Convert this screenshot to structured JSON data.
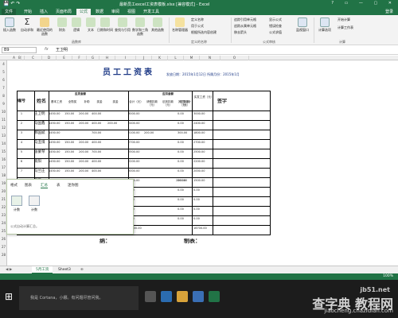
{
  "window": {
    "title": "最新员工excel工资表模板.xlsx [兼容模式] - Excel",
    "controls": "? ▭ — ▢ ✕"
  },
  "ribbon_tabs": [
    "文件",
    "开始",
    "插入",
    "页面布局",
    "公式",
    "数据",
    "审阅",
    "视图",
    "开发工具"
  ],
  "active_tab": "公式",
  "user": "登录",
  "ribbon": {
    "insert_function": "插入函数",
    "autosum": "自动求和",
    "recent": "最近使用的函数",
    "financial": "财务",
    "logical": "逻辑",
    "text": "文本",
    "datetime": "日期和时间",
    "lookup": "查找与引用",
    "math": "数学和三角函数",
    "more": "其他函数",
    "group_library": "函数库",
    "name_manager": "名称管理器",
    "define_name": "定义名称",
    "use_in_formula": "用于公式",
    "create_from_selection": "根据所选内容创建",
    "group_names": "定义的名称",
    "trace_precedents": "追踪引用单元格",
    "trace_dependents": "追踪从属单元格",
    "remove_arrows": "移去箭头",
    "show_formulas": "显示公式",
    "error_checking": "错误检查",
    "evaluate_formula": "公式求值",
    "group_auditing": "公式审核",
    "watch_window": "监视窗口",
    "calc_options": "计算选项",
    "calc_now": "开始计算",
    "calc_sheet": "计算工作表",
    "group_calc": "计算"
  },
  "formula_bar": {
    "name_box": "B9",
    "fx": "fx",
    "value": "王卫明"
  },
  "columns": [
    "A",
    "B",
    "C",
    "D",
    "E",
    "F",
    "G",
    "H",
    "I",
    "J",
    "K",
    "L",
    "M",
    "N",
    "O"
  ],
  "rows": [
    "4",
    "5",
    "6",
    "7",
    "8",
    "9",
    "10",
    "11",
    "12",
    "13",
    "14",
    "15",
    "16",
    "17",
    "18",
    "19",
    "20",
    "21",
    "22",
    "23",
    "24",
    "25",
    "26",
    "27",
    "28"
  ],
  "sheet": {
    "title": "员工工资表",
    "meta": "发放日期：2015年1月12日  所属月份：2015年1月",
    "h_no": "编号",
    "h_name": "姓名",
    "h_payable": "应发金额",
    "h_deduct": "应扣金额",
    "h_actual": "实发工资（元）",
    "h_sign": "签字",
    "sub_headers": [
      "基本工资",
      "全勤奖",
      "补助",
      "奖金",
      "奖金",
      "合计（元）",
      "请假扣款（元）",
      "迟到扣款（元）",
      "其它扣款（元）",
      "应扣合计（元）"
    ],
    "rows": [
      {
        "no": "1",
        "name": "王卫明",
        "vals": [
          "1450.00",
          "150.00",
          "200.00",
          "400.00",
          "",
          "3000.00",
          "",
          "",
          "",
          "0.00",
          "3000.00"
        ]
      },
      {
        "no": "2",
        "name": "马国鑫",
        "vals": [
          "1450.00",
          "150.00",
          "200.00",
          "400.00",
          "200.00",
          "2400.00",
          "",
          "",
          "",
          "0.00",
          "2400.00"
        ]
      },
      {
        "no": "3",
        "name": "郝国斌",
        "vals": [
          "1450.00",
          "",
          "",
          "700.00",
          "",
          "2100.00",
          "200.00",
          "",
          "",
          "300.00",
          "1800.00"
        ]
      },
      {
        "no": "4",
        "name": "马丑煤",
        "vals": [
          "1450.00",
          "150.00",
          "200.00",
          "400.00",
          "",
          "2700.00",
          "",
          "",
          "",
          "0.00",
          "2700.00"
        ]
      },
      {
        "no": "5",
        "name": "张蒙琴",
        "vals": [
          "1450.00",
          "150.00",
          "200.00",
          "700.00",
          "",
          "2500.00",
          "",
          "",
          "",
          "0.00",
          "2500.00"
        ]
      },
      {
        "no": "6",
        "name": "高阳",
        "vals": [
          "1450.00",
          "150.00",
          "200.00",
          "400.00",
          "",
          "2200.00",
          "",
          "",
          "",
          "0.00",
          "2200.00"
        ]
      },
      {
        "no": "7",
        "name": "马兰庄",
        "vals": [
          "1450.00",
          "150.00",
          "200.00",
          "400.00",
          "",
          "2000.00",
          "",
          "",
          "",
          "0.00",
          "2000.00"
        ]
      },
      {
        "no": "8",
        "name": "浑雁",
        "vals": [
          "1450.00",
          "0.00",
          "100.00",
          "150.00",
          "0.00",
          "1700.00",
          "",
          "",
          "200.00",
          "200.00",
          "1500.00"
        ]
      },
      {
        "no": "9",
        "name": "",
        "vals": [
          "",
          "",
          "",
          "",
          "",
          "0.00",
          "",
          "",
          "",
          "0.00",
          "0.00"
        ]
      },
      {
        "no": "",
        "name": "",
        "vals": [
          "",
          "",
          "",
          "",
          "",
          "0.00",
          "",
          "",
          "",
          "0.00",
          "0.00"
        ]
      },
      {
        "no": "",
        "name": "",
        "vals": [
          "",
          "",
          "",
          "",
          "",
          "0.00",
          "",
          "",
          "",
          "0.00",
          "0.00"
        ]
      },
      {
        "no": "",
        "name": "",
        "vals": [
          "",
          "",
          "",
          "",
          "",
          "0.00",
          "",
          "",
          "",
          "0.00",
          "0.00"
        ]
      },
      {
        "no": "",
        "name": "",
        "vals": [
          "",
          "",
          "",
          "",
          "",
          "18000.00",
          "",
          "",
          "",
          "",
          "16700.00"
        ]
      }
    ],
    "footer_left": "纳：",
    "footer_right": "制表："
  },
  "quick_analysis": {
    "tabs": [
      "格式",
      "图表",
      "汇总",
      "表",
      "迷你图"
    ],
    "active": "汇总",
    "items": [
      "计数",
      "计数"
    ],
    "desc": "公式自动计算汇总。"
  },
  "sheet_tabs": [
    "5月工资",
    "Sheet3"
  ],
  "active_sheet": "5月工资",
  "add_sheet": "⊕",
  "status": {
    "zoom": "100%"
  },
  "taskbar": {
    "search": "我是 Cortana，小娜。有问题尽管问我。"
  },
  "watermark": {
    "site": "jb51.net",
    "brand": "查字典 教程网",
    "url": "jiaocheng.chazidian.com"
  },
  "colors": {
    "excel_green": "#217346",
    "title_blue": "#1f3b87"
  }
}
